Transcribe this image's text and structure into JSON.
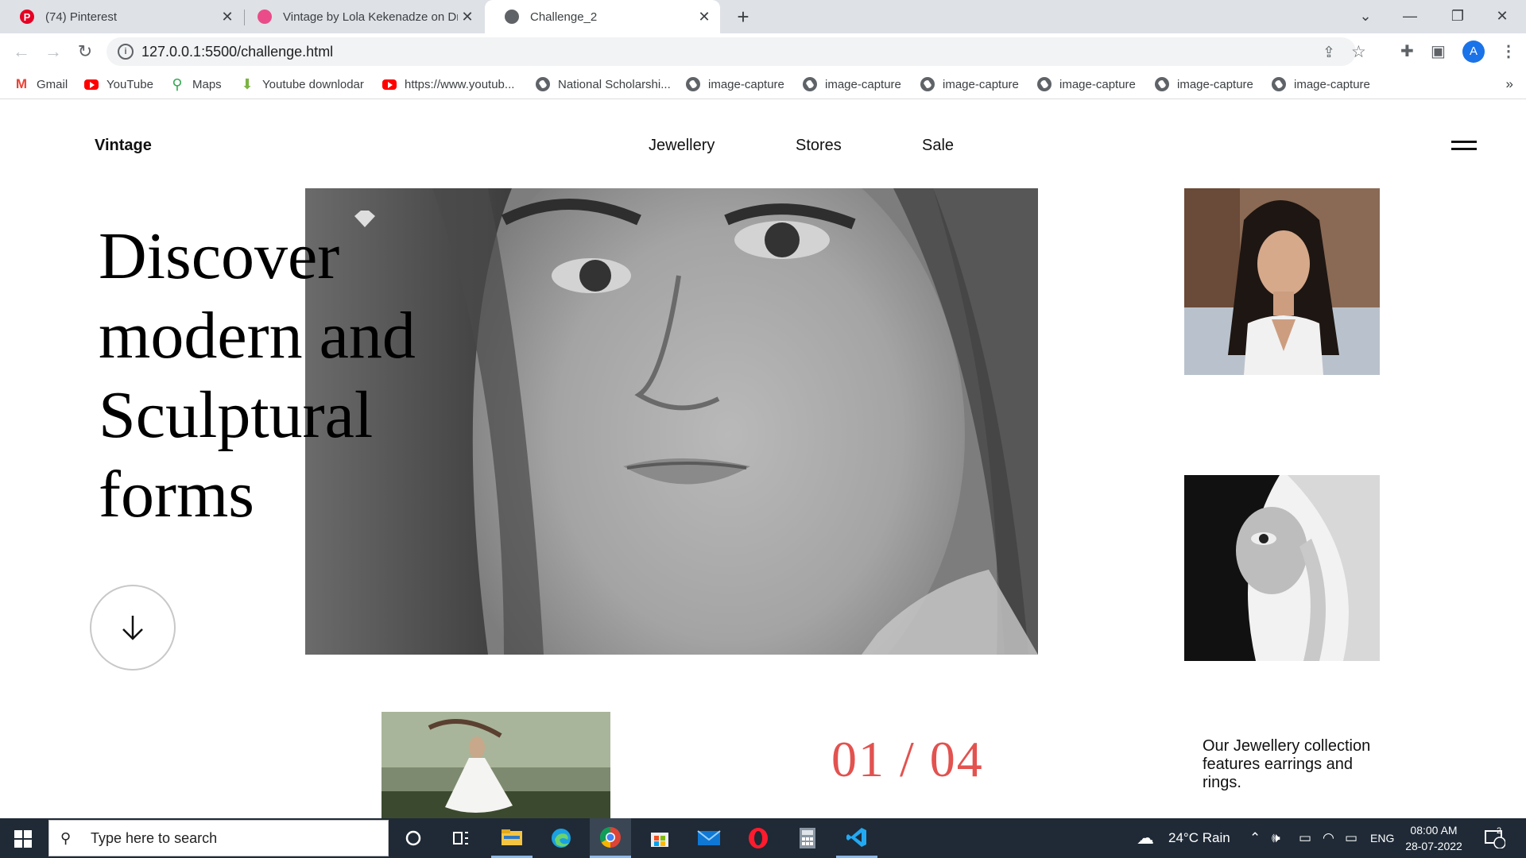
{
  "browser": {
    "tabs": [
      {
        "title": "(74) Pinterest",
        "favicon": "pinterest-icon",
        "active": false
      },
      {
        "title": "Vintage by Lola Kekenadze on Dribbble",
        "favicon": "dribbble-icon",
        "active": false
      },
      {
        "title": "Challenge_2",
        "favicon": "globe-icon",
        "active": true
      }
    ],
    "new_tab_label": "+",
    "url": "127.0.0.1:5500/challenge.html",
    "profile_initial": "A",
    "bookmarks": [
      {
        "label": "Gmail",
        "icon": "gmail-icon"
      },
      {
        "label": "YouTube",
        "icon": "youtube-icon"
      },
      {
        "label": "Maps",
        "icon": "maps-icon"
      },
      {
        "label": "Youtube downlodar",
        "icon": "download-icon"
      },
      {
        "label": "https://www.youtub...",
        "icon": "youtube-icon"
      },
      {
        "label": "National Scholarshi...",
        "icon": "globe-icon"
      },
      {
        "label": "image-capture",
        "icon": "globe-icon"
      },
      {
        "label": "image-capture",
        "icon": "globe-icon"
      },
      {
        "label": "image-capture",
        "icon": "globe-icon"
      },
      {
        "label": "image-capture",
        "icon": "globe-icon"
      },
      {
        "label": "image-capture",
        "icon": "globe-icon"
      },
      {
        "label": "image-capture",
        "icon": "globe-icon"
      }
    ],
    "bookmarks_overflow": "»"
  },
  "site": {
    "logo": "Vintage",
    "nav": [
      "Jewellery",
      "Stores",
      "Sale"
    ],
    "headline": "Discover modern and Sculptural forms",
    "counter": "01 / 04",
    "description": "Our Jewellery collection features earrings and rings.",
    "accent_color": "#e2524f"
  },
  "taskbar": {
    "search_placeholder": "Type here to search",
    "weather": "24°C  Rain",
    "language": "ENG",
    "time": "08:00 AM",
    "date": "28-07-2022",
    "notifications": "2",
    "apps": [
      "cortana-icon",
      "task-view-icon",
      "file-explorer-icon",
      "edge-icon",
      "chrome-icon",
      "store-icon",
      "mail-icon",
      "opera-icon",
      "calculator-icon",
      "vscode-icon"
    ]
  }
}
